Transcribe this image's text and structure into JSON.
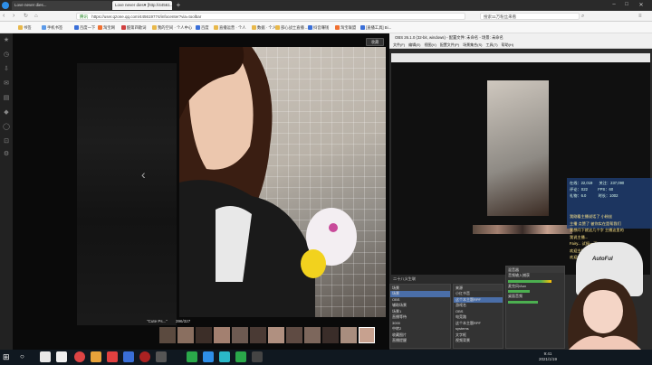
{
  "browser": {
    "tabs": [
      "Love never dies...",
      "Love never dies♥ [http://44561..."
    ],
    "address_prefix": "腾讯",
    "url": "https://user.qzone.qq.com/445619774/infocenter?via=toolbar",
    "search_text": "搜索11万粉丝来看",
    "bookmarks": [
      "书签",
      "手机书签",
      "百度一下",
      "淘宝网",
      "酷第四歌词",
      "我的空间 · 个人中心",
      "百度",
      "直播运营 · 个人",
      "数据 · 个人",
      "部心战士直播 ...",
      "抖音赚钱",
      "淘宝联盟",
      "[直播工具] Bi..."
    ],
    "viewer_close": "收藏",
    "caption": "\"Cute Ps...\"",
    "counter": "396/327"
  },
  "obs": {
    "title": "OBS 26.1.0 (32-bit, windows) - 配置文件: 未命名 - 场景: 未命名",
    "menu": [
      "文件(F)",
      "编辑(E)",
      "视图(V)",
      "配置文件(P)",
      "场景集合(S)",
      "工具(T)",
      "帮助(H)"
    ],
    "scenes_header": "场景",
    "scenes": [
      "场景",
      "OBS",
      "辅助场景",
      "场景1",
      "直播等待",
      "3000",
      "中转2",
      "收藏图片",
      "直播提醒",
      "宣传画面"
    ],
    "sources_header": "来源",
    "sources": [
      "小红书音",
      "这个本主题RPF",
      "游戏名",
      "OBS",
      "电竞路",
      "这个本主题RPF",
      "systems",
      "文字框",
      "视频背景",
      "宣传图画"
    ],
    "mixer_header": "混音器",
    "controls_header": "控制",
    "audio_labels": [
      "音频输入捕获",
      "麦克风/Aux",
      "桌面音频"
    ],
    "source_label": "二十八义生联"
  },
  "stream_stats": {
    "viewers": "在线：22,019",
    "likes": "关注：237,090",
    "comments": "评论：S22",
    "fps": "FPS：60",
    "gifts": "礼物：6.0",
    "time": "时长：1002"
  },
  "chat": [
    "我刚看主播说话了 小粉丝",
    "主播 点赞了 被你实在是帮我们",
    "我想问下就这几个字 主播这里的",
    "我说主播...",
    "Fairy... 试探一下 1?",
    "欢迎主播 来(1MT)",
    "欢迎主播 (1MT)"
  ],
  "overlay": {
    "brand": "AutoFul"
  },
  "taskbar": {
    "clock": "9:41",
    "date": "2021/1/19"
  },
  "colors": {
    "accent": "#4a6ea8",
    "chat_text": "#ffe68a",
    "obs_bg": "#2b2b2b"
  }
}
